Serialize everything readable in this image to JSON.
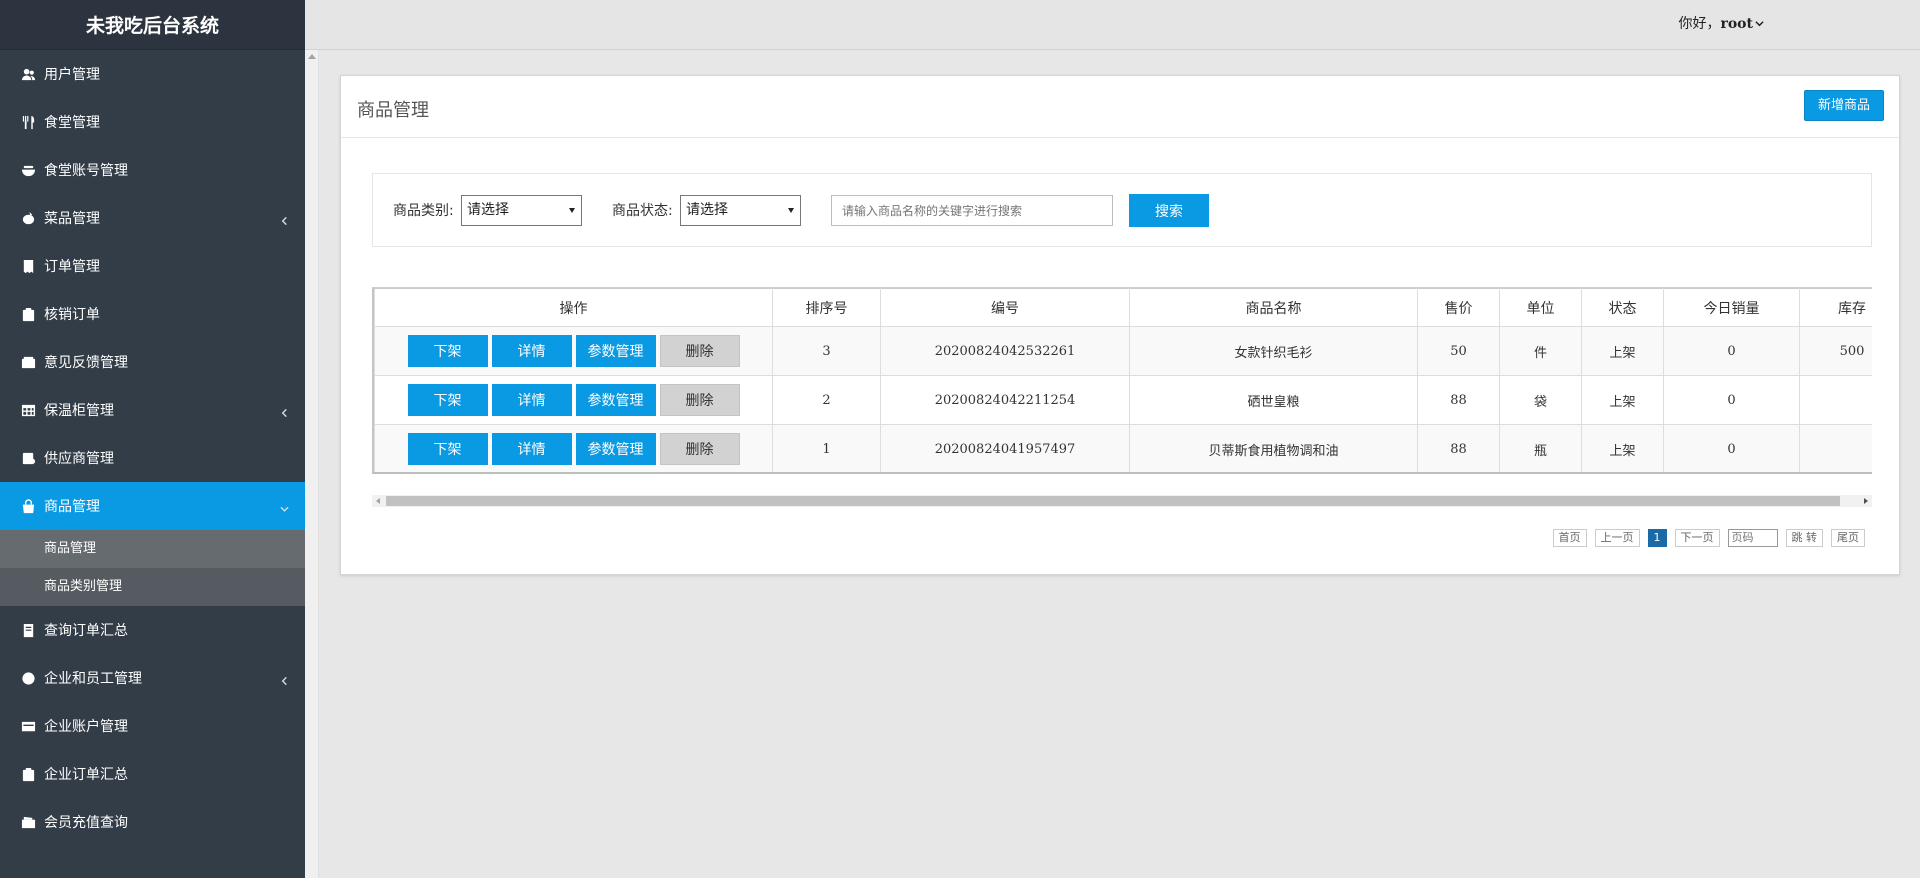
{
  "app": {
    "title": "未我吃后台系统"
  },
  "header": {
    "greeting": "你好，",
    "username": "root"
  },
  "sidebar": {
    "items": [
      {
        "label": "用户管理",
        "icon": "users-icon"
      },
      {
        "label": "食堂管理",
        "icon": "utensils-icon"
      },
      {
        "label": "食堂账号管理",
        "icon": "bowl-icon"
      },
      {
        "label": "菜品管理",
        "icon": "dish-icon",
        "has_children": true
      },
      {
        "label": "订单管理",
        "icon": "receipt-icon"
      },
      {
        "label": "核销订单",
        "icon": "clipboard-check-icon"
      },
      {
        "label": "意见反馈管理",
        "icon": "envelope-icon"
      },
      {
        "label": "保温柜管理",
        "icon": "grid-icon",
        "has_children": true
      },
      {
        "label": "供应商管理",
        "icon": "supplier-icon"
      },
      {
        "label": "商品管理",
        "icon": "bag-icon",
        "active": true
      },
      {
        "label": "查询订单汇总",
        "icon": "report-icon"
      },
      {
        "label": "企业和员工管理",
        "icon": "company-icon",
        "has_children": true
      },
      {
        "label": "企业账户管理",
        "icon": "card-icon"
      },
      {
        "label": "企业订单汇总",
        "icon": "clipboard-icon"
      },
      {
        "label": "会员充值查询",
        "icon": "wallet-icon"
      }
    ],
    "submenu": [
      {
        "label": "商品管理",
        "selected": true
      },
      {
        "label": "商品类别管理",
        "selected": false
      }
    ]
  },
  "panel": {
    "title": "商品管理",
    "add_button": "新增商品"
  },
  "filter": {
    "category_label": "商品类别:",
    "category_value": "请选择",
    "status_label": "商品状态:",
    "status_value": "请选择",
    "search_placeholder": "请输入商品名称的关键字进行搜索",
    "search_button": "搜索"
  },
  "table": {
    "columns": [
      "操作",
      "排序号",
      "编号",
      "商品名称",
      "售价",
      "单位",
      "状态",
      "今日销量",
      "库存"
    ],
    "actions": [
      "下架",
      "详情",
      "参数管理",
      "删除"
    ],
    "rows": [
      {
        "sort": "3",
        "code": "20200824042532261",
        "name": "女款针织毛衫",
        "price": "50",
        "unit": "件",
        "status": "上架",
        "today_sales": "0",
        "stock": "500"
      },
      {
        "sort": "2",
        "code": "20200824042211254",
        "name": "硒世皇粮",
        "price": "88",
        "unit": "袋",
        "status": "上架",
        "today_sales": "0",
        "stock": ""
      },
      {
        "sort": "1",
        "code": "20200824041957497",
        "name": "贝蒂斯食用植物调和油",
        "price": "88",
        "unit": "瓶",
        "status": "上架",
        "today_sales": "0",
        "stock": ""
      }
    ]
  },
  "pager": {
    "first": "首页",
    "prev": "上一页",
    "current": "1",
    "next": "下一页",
    "page_placeholder": "页码",
    "jump": "跳 转",
    "last": "尾页"
  },
  "colors": {
    "accent": "#0a9ae3",
    "sidebar_bg": "#333d47",
    "submenu_selected": "#666b70"
  }
}
